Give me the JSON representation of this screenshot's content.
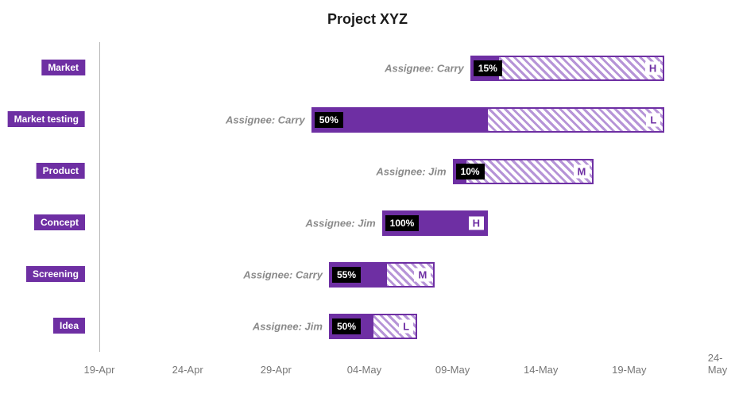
{
  "title": "Project XYZ",
  "colors": {
    "primary": "#6e2fa3",
    "badgeBg": "#000000",
    "axisText": "#777777"
  },
  "assignee_prefix": "Assignee: ",
  "chart_data": {
    "type": "bar",
    "orientation": "horizontal",
    "title": "Project XYZ",
    "xlabel": "",
    "ylabel": "",
    "x_type": "date",
    "x_ticks": [
      "19-Apr",
      "24-Apr",
      "29-Apr",
      "04-May",
      "09-May",
      "14-May",
      "19-May",
      "24-May"
    ],
    "x_range_days": [
      0,
      35
    ],
    "tasks": [
      {
        "name": "Market",
        "assignee": "Carry",
        "start_day": 21,
        "duration_days": 11,
        "progress_pct": 15,
        "priority": "H"
      },
      {
        "name": "Market testing",
        "assignee": "Carry",
        "start_day": 12,
        "duration_days": 20,
        "progress_pct": 50,
        "priority": "L"
      },
      {
        "name": "Product",
        "assignee": "Jim",
        "start_day": 20,
        "duration_days": 8,
        "progress_pct": 10,
        "priority": "M"
      },
      {
        "name": "Concept",
        "assignee": "Jim",
        "start_day": 16,
        "duration_days": 6,
        "progress_pct": 100,
        "priority": "H"
      },
      {
        "name": "Screening",
        "assignee": "Carry",
        "start_day": 13,
        "duration_days": 6,
        "progress_pct": 55,
        "priority": "M"
      },
      {
        "name": "Idea",
        "assignee": "Jim",
        "start_day": 13,
        "duration_days": 5,
        "progress_pct": 50,
        "priority": "L"
      }
    ]
  }
}
